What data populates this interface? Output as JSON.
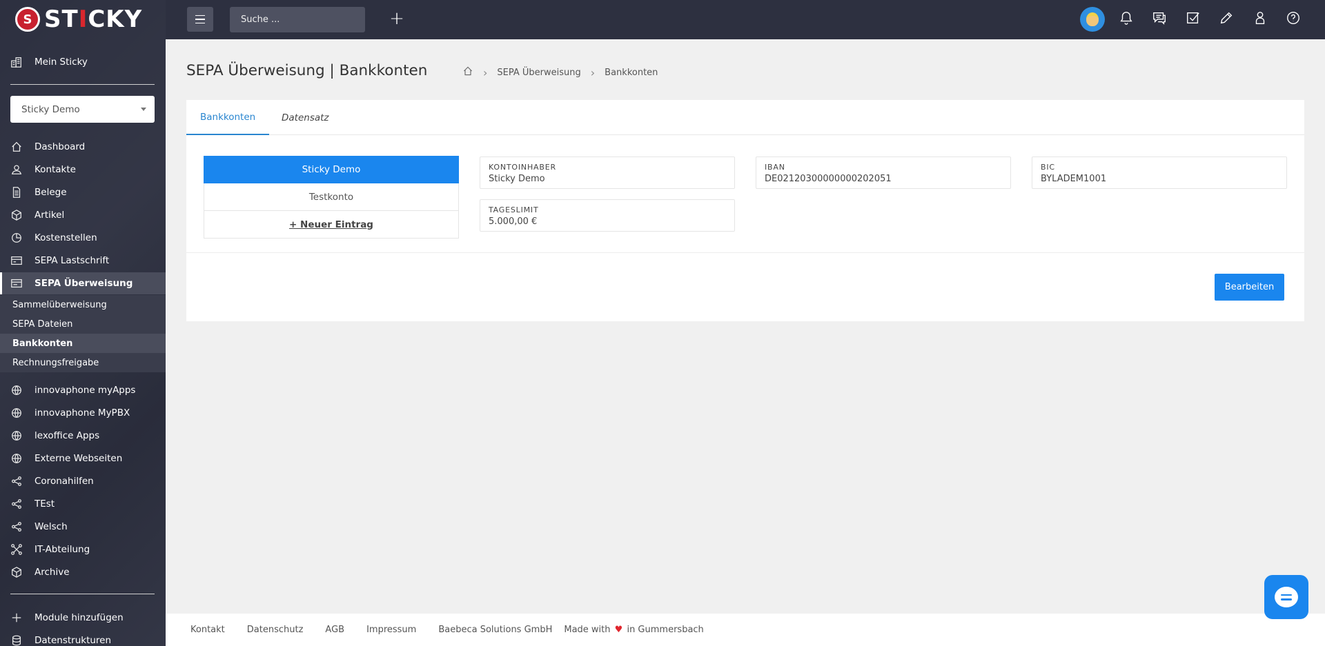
{
  "brand": {
    "logo_letter": "S",
    "name_a": "ST",
    "name_b": "I",
    "name_c": "CKY"
  },
  "topbar": {
    "search_placeholder": "Suche ...",
    "add_label": "+"
  },
  "sidebar": {
    "home": "Mein Sticky",
    "workspace": "Sticky Demo",
    "items": [
      {
        "label": "Dashboard",
        "icon": "home-icon"
      },
      {
        "label": "Kontakte",
        "icon": "contacts-icon"
      },
      {
        "label": "Belege",
        "icon": "document-icon"
      },
      {
        "label": "Artikel",
        "icon": "box-icon"
      },
      {
        "label": "Kostenstellen",
        "icon": "pie-icon"
      },
      {
        "label": "SEPA Lastschrift",
        "icon": "card-icon"
      },
      {
        "label": "SEPA Überweisung",
        "icon": "transfer-icon"
      }
    ],
    "subitems": [
      "Sammelüberweisung",
      "SEPA Dateien",
      "Bankkonten",
      "Rechnungsfreigabe"
    ],
    "apps": [
      {
        "label": "innovaphone myApps",
        "icon": "globe-icon"
      },
      {
        "label": "innovaphone MyPBX",
        "icon": "globe-icon"
      },
      {
        "label": "lexoffice Apps",
        "icon": "globe-icon"
      },
      {
        "label": "Externe Webseiten",
        "icon": "globe-icon"
      },
      {
        "label": "Coronahilfen",
        "icon": "share-icon"
      },
      {
        "label": "TEst",
        "icon": "share-icon"
      },
      {
        "label": "Welsch",
        "icon": "share-icon"
      },
      {
        "label": "IT-Abteilung",
        "icon": "network-icon"
      },
      {
        "label": "Archive",
        "icon": "box-icon"
      }
    ],
    "add_module": "Module hinzufügen",
    "datastructures": "Datenstrukturen"
  },
  "page": {
    "title": "SEPA Überweisung | Bankkonten",
    "breadcrumb": [
      "SEPA Überweisung",
      "Bankkonten"
    ]
  },
  "tabs": [
    "Bankkonten",
    "Datensatz"
  ],
  "accounts": [
    "Sticky Demo",
    "Testkonto"
  ],
  "new_entry": "+ Neuer Eintrag",
  "fields": {
    "owner": {
      "label": "Kontoinhaber",
      "value": "Sticky Demo"
    },
    "iban": {
      "label": "IBAN",
      "value": "DE02120300000000202051"
    },
    "bic": {
      "label": "BIC",
      "value": "BYLADEM1001"
    },
    "limit": {
      "label": "Tageslimit",
      "value": "5.000,00 €"
    }
  },
  "edit_button": "Bearbeiten",
  "footer": {
    "links": [
      "Kontakt",
      "Datenschutz",
      "AGB",
      "Impressum",
      "Baebeca Solutions GmbH"
    ],
    "made_pre": "Made with",
    "made_post": "in Gummersbach"
  },
  "colors": {
    "accent": "#1a86ee",
    "sidebar": "#2d3040",
    "heart": "#e0262e"
  }
}
